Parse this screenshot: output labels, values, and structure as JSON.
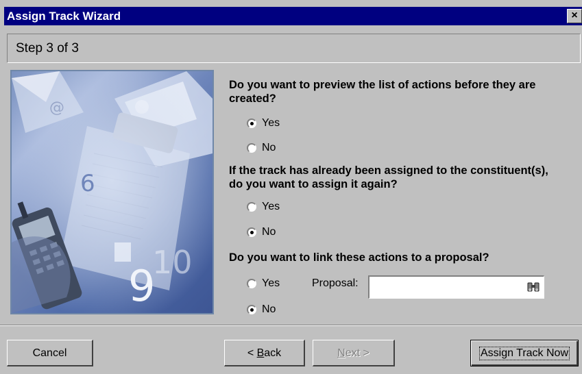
{
  "window": {
    "title": "Assign Track Wizard",
    "close_glyph": "×"
  },
  "step": {
    "label": "Step 3 of 3"
  },
  "questions": {
    "preview": {
      "text": "Do you want to preview the list of actions before they are created?",
      "yes_label": "Yes",
      "no_label": "No",
      "selected": "Yes"
    },
    "reassign": {
      "text": "If the track has already been assigned to the constituent(s), do you want to assign it again?",
      "yes_label": "Yes",
      "no_label": "No",
      "selected": "No"
    },
    "proposal": {
      "text": "Do you want to link these actions to a proposal?",
      "yes_label": "Yes",
      "no_label": "No",
      "selected": "No",
      "field_label": "Proposal:",
      "field_value": "",
      "lookup_icon": "binoculars-icon"
    }
  },
  "buttons": {
    "cancel": "Cancel",
    "back_prefix": "< ",
    "back_mnemonic": "B",
    "back_rest": "ack",
    "next_mnemonic": "N",
    "next_rest": "ext >",
    "assign": "Assign Track Now"
  }
}
